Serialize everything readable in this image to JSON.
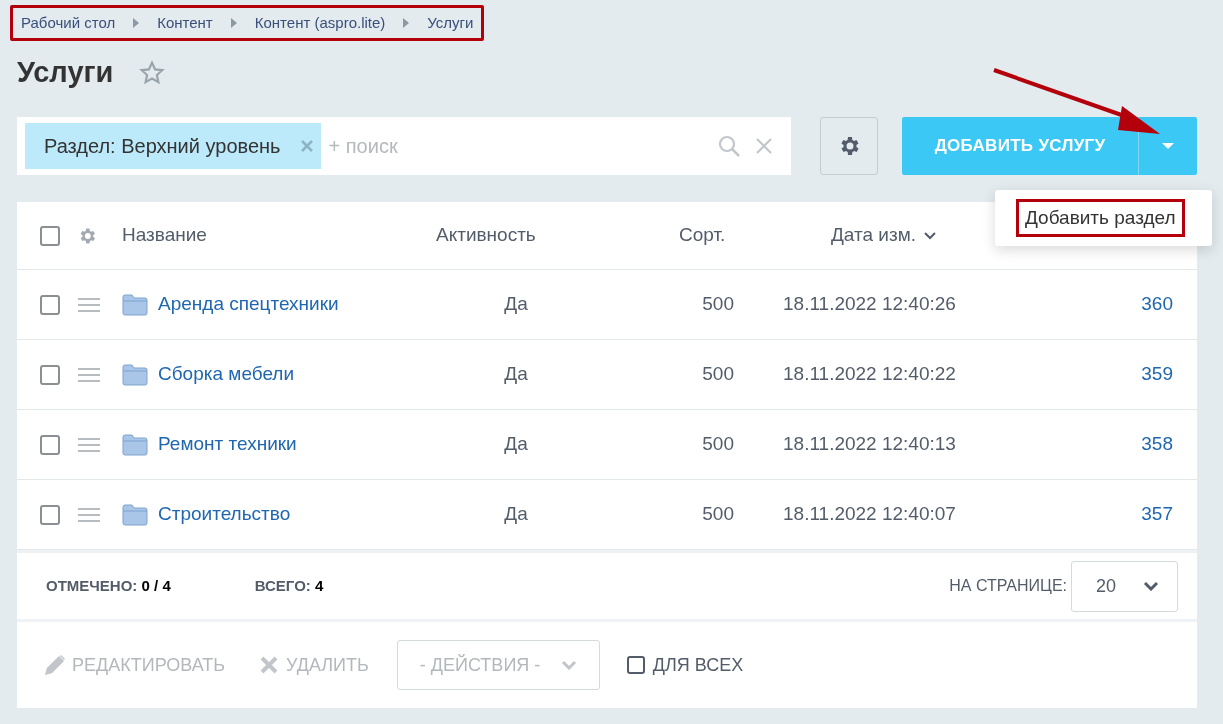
{
  "breadcrumbs": {
    "highlighted": true,
    "items": [
      "Рабочий стол",
      "Контент",
      "Контент (aspro.lite)",
      "Услуги"
    ]
  },
  "title": "Услуги",
  "favorite": false,
  "filter": {
    "tag": "Раздел: Верхний уровень",
    "placeholder": "+ поиск"
  },
  "add_button": {
    "label": "ДОБАВИТЬ УСЛУГУ"
  },
  "dropdown": {
    "items": [
      {
        "label": "Добавить раздел",
        "highlighted": true
      }
    ]
  },
  "table": {
    "select_all_checked": false,
    "columns": [
      "Название",
      "Активность",
      "Сорт.",
      "Дата изм."
    ],
    "rows": [
      {
        "name": "Аренда спецтехники",
        "active": "Да",
        "sort": "500",
        "date": "18.11.2022 12:40:26",
        "id": "360",
        "checked": false
      },
      {
        "name": "Сборка мебели",
        "active": "Да",
        "sort": "500",
        "date": "18.11.2022 12:40:22",
        "id": "359",
        "checked": false
      },
      {
        "name": "Ремонт техники",
        "active": "Да",
        "sort": "500",
        "date": "18.11.2022 12:40:13",
        "id": "358",
        "checked": false
      },
      {
        "name": "Строительство",
        "active": "Да",
        "sort": "500",
        "date": "18.11.2022 12:40:07",
        "id": "357",
        "checked": false
      }
    ]
  },
  "footer": {
    "marked_label": "ОТМЕЧЕНО:",
    "marked_value": "0 / 4",
    "total_label": "ВСЕГО:",
    "total_value": "4",
    "per_page_label": "НА СТРАНИЦЕ:",
    "per_page": "20"
  },
  "actions": {
    "edit": "РЕДАКТИРОВАТЬ",
    "delete": "УДАЛИТЬ",
    "select": "- ДЕЙСТВИЯ -",
    "for_all": "ДЛЯ ВСЕХ",
    "for_all_checked": false
  }
}
